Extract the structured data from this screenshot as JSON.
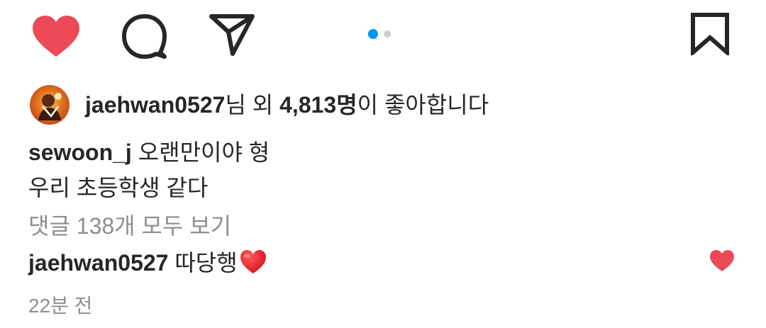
{
  "colors": {
    "text": "#262626",
    "secondary": "#8e8e8e",
    "like_red": "#ed4956",
    "dot_active": "#0095f6",
    "dot_inactive": "#cccccc",
    "icon_stroke": "#262626"
  },
  "actions": {
    "like_icon": "heart-filled",
    "comment_icon": "speech-bubble",
    "share_icon": "paper-plane",
    "save_icon": "bookmark"
  },
  "carousel": {
    "total": 2,
    "active_index": 0
  },
  "likes": {
    "first_user": "jaehwan0527",
    "suffix_1": "님 외 ",
    "count": "4,813명",
    "suffix_2": "이 좋아합니다"
  },
  "caption": {
    "username": "sewoon_j",
    "line1": " 오랜만이야 형",
    "line2": "우리 초등학생 같다"
  },
  "view_comments": "댓글 138개 모두 보기",
  "comment": {
    "username": "jaehwan0527",
    "text": " 따당행"
  },
  "timestamp": "22분 전"
}
